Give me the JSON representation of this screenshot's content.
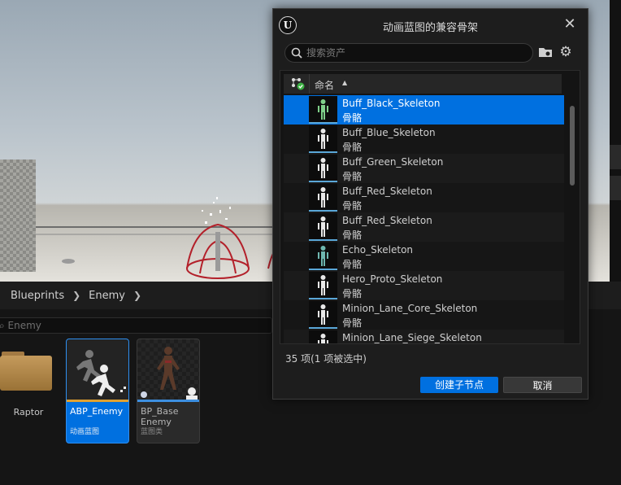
{
  "content_browser": {
    "breadcrumbs": [
      "Blueprints",
      "Enemy"
    ],
    "search_text": "Enemy",
    "folder": {
      "label": "Raptor"
    },
    "assets": [
      {
        "name": "ABP_Enemy",
        "type": "动画蓝图",
        "accent_color": "#e0a030"
      },
      {
        "name_line1": "BP_Base",
        "name_line2": "Enemy",
        "type": "蓝图类",
        "accent_color": "#3d8fe0"
      }
    ]
  },
  "dialog": {
    "title": "动画蓝图的兼容骨架",
    "search_placeholder": "搜索资产",
    "column_header": "命名",
    "items": [
      {
        "name": "Buff_Black_Skeleton",
        "type": "骨骼",
        "selected": true
      },
      {
        "name": "Buff_Blue_Skeleton",
        "type": "骨骼"
      },
      {
        "name": "Buff_Green_Skeleton",
        "type": "骨骼"
      },
      {
        "name": "Buff_Red_Skeleton",
        "type": "骨骼"
      },
      {
        "name": "Buff_Red_Skeleton",
        "type": "骨骼"
      },
      {
        "name": "Echo_Skeleton",
        "type": "骨骼"
      },
      {
        "name": "Hero_Proto_Skeleton",
        "type": "骨骼"
      },
      {
        "name": "Minion_Lane_Core_Skeleton",
        "type": "骨骼"
      },
      {
        "name": "Minion_Lane_Siege_Skeleton",
        "type": "骨骼"
      }
    ],
    "status": "35 项(1 项被选中)",
    "create_button": "创建子节点",
    "cancel_button": "取消",
    "selection_color": "#0070e0"
  },
  "icons": {
    "logo": "unreal-logo-icon",
    "close": "close-icon",
    "search": "search-icon",
    "folder": "folder-icon",
    "settings": "gear-icon",
    "filter": "skeleton-filter-icon",
    "sort": "sort-ascending-icon"
  }
}
